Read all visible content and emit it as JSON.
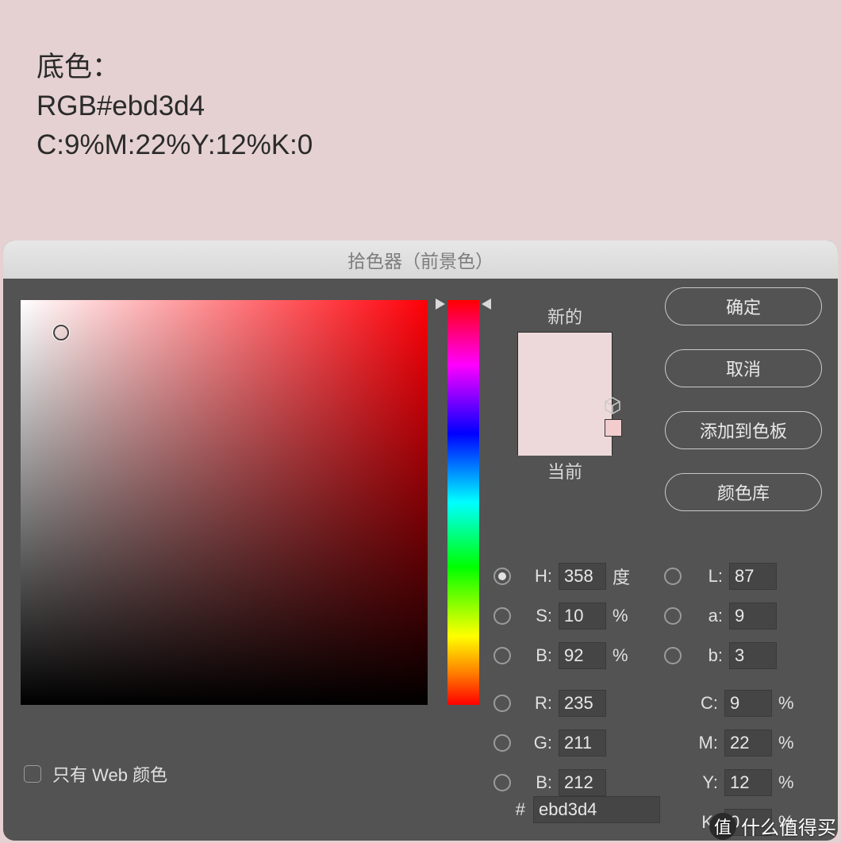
{
  "background": {
    "label_line1": "底色：",
    "label_line2": "RGB#ebd3d4",
    "label_line3": "C:9%M:22%Y:12%K:0"
  },
  "dialog": {
    "title": "拾色器（前景色）",
    "buttons": {
      "ok": "确定",
      "cancel": "取消",
      "add_swatch": "添加到色板",
      "color_libs": "颜色库"
    },
    "swatch": {
      "new_label": "新的",
      "current_label": "当前",
      "new_color": "#eed9da",
      "current_color": "#eed9da",
      "mini_color": "#f3cccd"
    },
    "sat_cursor": {
      "x_pct": 10,
      "y_pct": 8
    },
    "hue_cursor": {
      "y_pct": 1
    },
    "fields": {
      "H": {
        "label": "H:",
        "value": "358",
        "unit": "度"
      },
      "S": {
        "label": "S:",
        "value": "10",
        "unit": "%"
      },
      "Bhsb": {
        "label": "B:",
        "value": "92",
        "unit": "%"
      },
      "L": {
        "label": "L:",
        "value": "87"
      },
      "a": {
        "label": "a:",
        "value": "9"
      },
      "bLab": {
        "label": "b:",
        "value": "3"
      },
      "R": {
        "label": "R:",
        "value": "235"
      },
      "G": {
        "label": "G:",
        "value": "211"
      },
      "Brgb": {
        "label": "B:",
        "value": "212"
      },
      "C": {
        "label": "C:",
        "value": "9",
        "unit": "%"
      },
      "M": {
        "label": "M:",
        "value": "22",
        "unit": "%"
      },
      "Y": {
        "label": "Y:",
        "value": "12",
        "unit": "%"
      },
      "K": {
        "label": "K:",
        "value": "0",
        "unit": "%"
      },
      "hex": {
        "label": "#",
        "value": "ebd3d4"
      }
    },
    "web_only": "只有 Web 颜色"
  },
  "watermark": {
    "badge": "值",
    "text": "什么值得买"
  }
}
